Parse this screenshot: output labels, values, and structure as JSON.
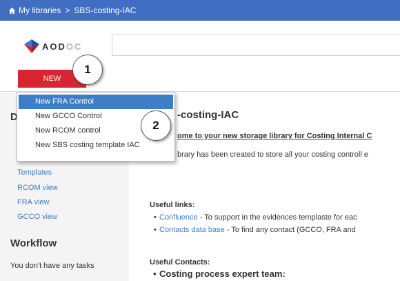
{
  "breadcrumb": {
    "home_label": "My libraries",
    "separator": ">",
    "current": "SBS-costing-IAC"
  },
  "header": {
    "logo_text_main": "AOD",
    "logo_text_faded": "OC",
    "search_value": "",
    "new_button_label": "NEW"
  },
  "callouts": [
    "1",
    "2"
  ],
  "dropdown": {
    "items": [
      {
        "label": "New FRA Control",
        "active": true
      },
      {
        "label": "New GCCO Control",
        "active": false
      },
      {
        "label": "New RCOM control",
        "active": false
      },
      {
        "label": "New SBS costing template IAC",
        "active": false
      }
    ]
  },
  "sidebar": {
    "section1_title_visible": "D",
    "links": [
      "Templates",
      "RCOM view",
      "FRA view",
      "GCCO view"
    ],
    "workflow_title": "Workflow",
    "workflow_note": "You don't have any tasks"
  },
  "main": {
    "title_visible": "-costing-IAC",
    "welcome_visible": "ome to your new storage library for Costing Internal C",
    "desc_visible": "brary has been created to store all your costing controll e",
    "useful_links_label": "Useful links:",
    "links": [
      {
        "link": "Confluence",
        "text": " - To support in the evidences templaste for eac"
      },
      {
        "link": "Contacts data base",
        "text": " - To find any contact (GCCO, FRA and"
      }
    ],
    "useful_contacts_label": "Useful Contacts:",
    "contacts": [
      "Costing process expert team:"
    ]
  },
  "colors": {
    "topbar": "#3f6ec2",
    "new_button": "#d9252f",
    "menu_highlight": "#3f7ec7",
    "link": "#3d7cc9"
  }
}
